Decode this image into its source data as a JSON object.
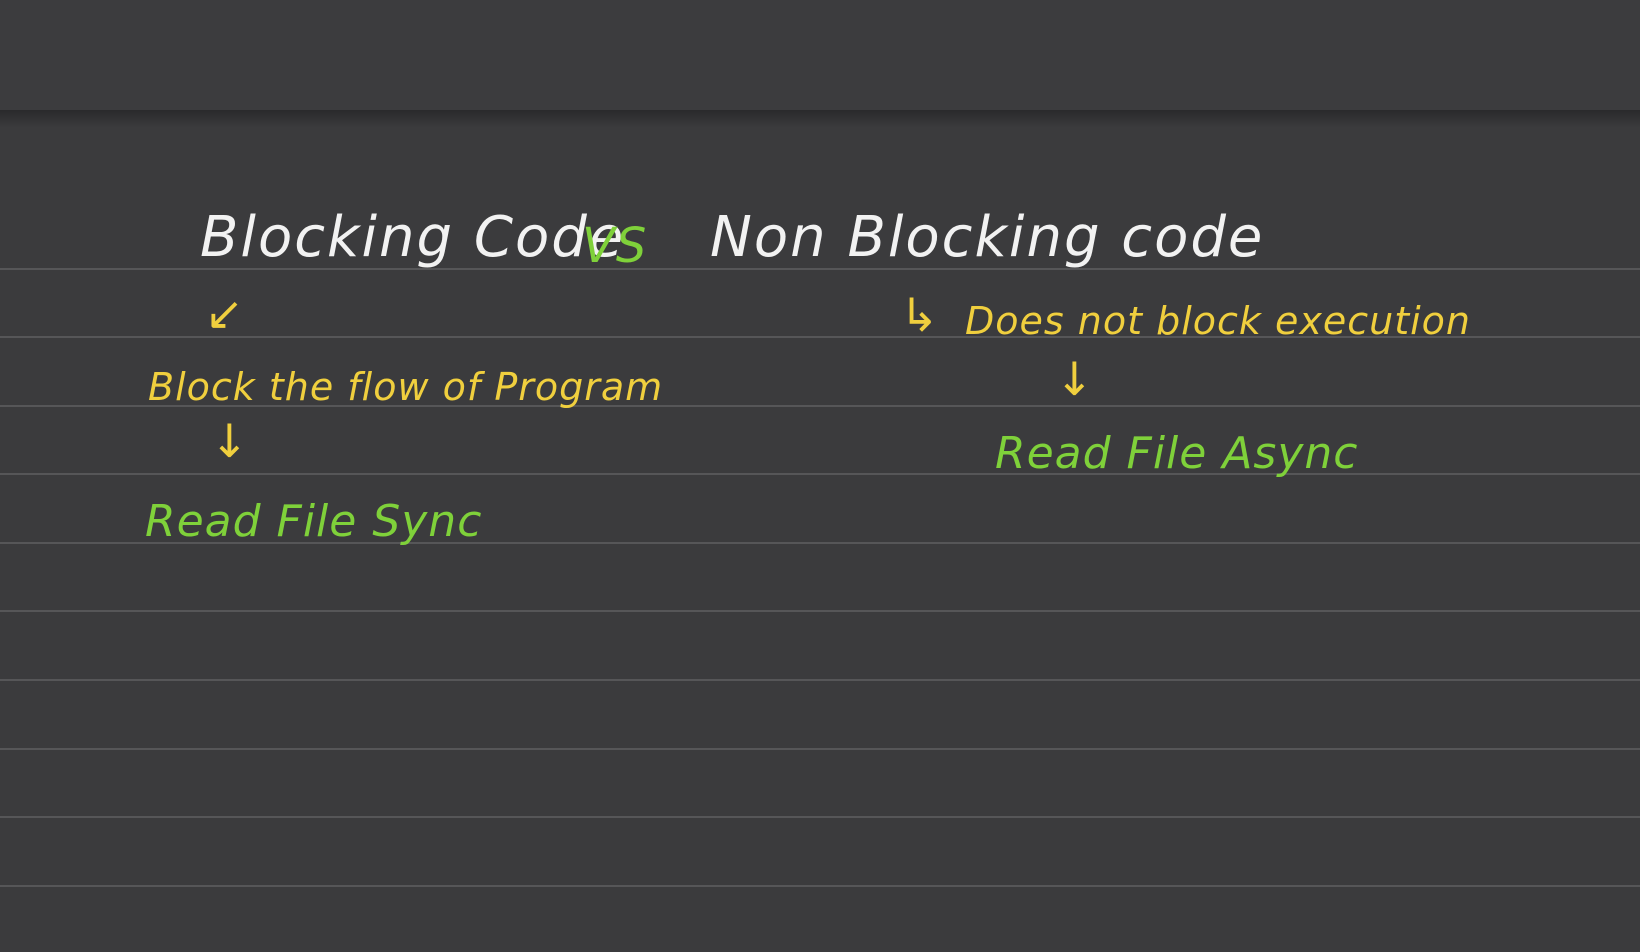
{
  "heading": {
    "left": "Blocking Code",
    "vs": "VS",
    "right": "Non Blocking code"
  },
  "blocking": {
    "arrow_1": "↙",
    "description": "Block the flow of Program",
    "arrow_2": "↓",
    "example": "Read File Sync"
  },
  "non_blocking": {
    "arrow_1": "↳",
    "description": "Does not block execution",
    "arrow_2": "↓",
    "example": "Read File Async"
  },
  "colors": {
    "background": "#3b3b3d",
    "title_ink": "#f2f2f2",
    "description_ink": "#f0cf3e",
    "example_ink": "#7fd13a",
    "ruled_line": "#6e6e70"
  }
}
